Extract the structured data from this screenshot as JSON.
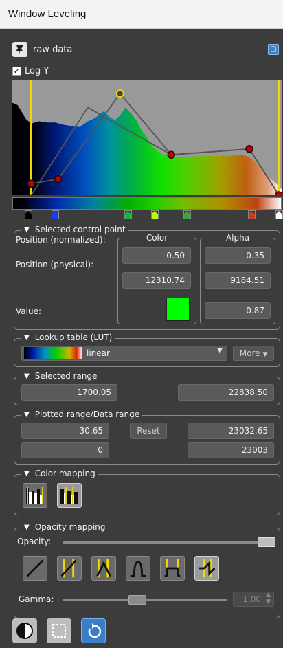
{
  "title": "Window Leveling",
  "header": {
    "name": "raw data",
    "log_y_label": "Log Y",
    "log_y_checked": true
  },
  "chart_data": {
    "type": "area",
    "title": "",
    "xlabel": "",
    "ylabel": "",
    "log_y": true,
    "histogram_x": [
      0.0,
      0.02,
      0.05,
      0.07,
      0.1,
      0.13,
      0.16,
      0.19,
      0.22,
      0.25,
      0.28,
      0.3,
      0.32,
      0.34,
      0.36,
      0.38,
      0.4,
      0.42,
      0.44,
      0.46,
      0.48,
      0.5,
      0.52,
      0.55,
      0.6,
      0.65,
      0.7,
      0.75,
      0.8,
      0.85,
      0.88,
      0.9,
      0.92,
      0.94,
      0.96,
      0.98,
      1.0
    ],
    "histogram_y": [
      0.8,
      0.78,
      0.66,
      0.62,
      0.64,
      0.63,
      0.63,
      0.61,
      0.6,
      0.59,
      0.64,
      0.66,
      0.69,
      0.73,
      0.68,
      0.65,
      0.69,
      0.76,
      0.71,
      0.65,
      0.56,
      0.5,
      0.42,
      0.36,
      0.33,
      0.33,
      0.34,
      0.34,
      0.34,
      0.35,
      0.33,
      0.29,
      0.24,
      0.18,
      0.14,
      0.1,
      0.05
    ],
    "color_function": [
      [
        0.07,
        0.0
      ],
      [
        0.28,
        0.76
      ],
      [
        0.59,
        0.35
      ],
      [
        0.88,
        0.4
      ],
      [
        0.99,
        0.0
      ]
    ],
    "opacity_function": [
      [
        0.07,
        0.1
      ],
      [
        0.17,
        0.14
      ],
      [
        0.4,
        0.88
      ],
      [
        0.59,
        0.35
      ],
      [
        0.88,
        0.4
      ],
      [
        0.99,
        0.0
      ]
    ],
    "range_lines": [
      0.07,
      0.99
    ],
    "markers": [
      {
        "x": 0.06,
        "color": "#000000"
      },
      {
        "x": 0.16,
        "color": "#1a3cff"
      },
      {
        "x": 0.43,
        "color": "#1bb53a"
      },
      {
        "x": 0.53,
        "color": "#b4ff00"
      },
      {
        "x": 0.65,
        "color": "#3aa53a"
      },
      {
        "x": 0.89,
        "color": "#c0401c"
      },
      {
        "x": 0.99,
        "color": "#ffffff"
      }
    ]
  },
  "selected_point": {
    "title": "Selected control point",
    "color_header": "Color",
    "alpha_header": "Alpha",
    "pos_norm_label": "Position (normalized):",
    "pos_phys_label": "Position (physical):",
    "value_label": "Value:",
    "color_pos_norm": "0.50",
    "color_pos_phys": "12310.74",
    "color_value": "#00ff00",
    "alpha_pos_norm": "0.35",
    "alpha_pos_phys": "9184.51",
    "alpha_value": "0.87"
  },
  "lut": {
    "title": "Lookup table (LUT)",
    "selected": "linear",
    "more": "More"
  },
  "selected_range": {
    "title": "Selected range",
    "min": "1700.05",
    "max": "22838.50"
  },
  "plotted_range": {
    "title": "Plotted range/Data range",
    "plot_min": "30.65",
    "reset": "Reset",
    "plot_max": "23032.65",
    "data_min": "0",
    "data_max": "23003"
  },
  "color_mapping": {
    "title": "Color mapping"
  },
  "opacity_mapping": {
    "title": "Opacity mapping",
    "opacity_label": "Opacity:",
    "opacity_value": 1.0,
    "gamma_label": "Gamma:",
    "gamma_value": "1.00",
    "gamma_slider": 0.45
  },
  "colors": {
    "accent": "#3b7ec8",
    "panel": "#3c3c3c",
    "field": "#5a5a5a"
  }
}
